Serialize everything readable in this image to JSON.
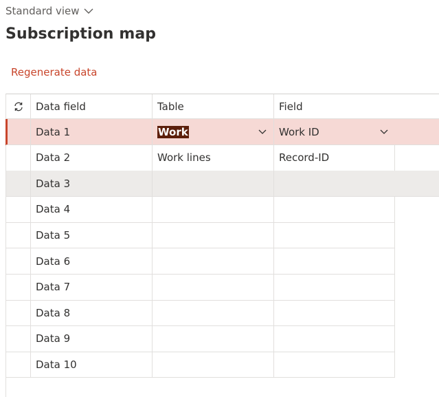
{
  "view": {
    "label": "Standard view"
  },
  "page": {
    "title": "Subscription map"
  },
  "actions": {
    "regenerate_label": "Regenerate data"
  },
  "grid": {
    "columns": [
      "Data field",
      "Table",
      "Field"
    ],
    "rows": [
      {
        "data_field": "Data 1",
        "table": "Work",
        "field": "Work ID"
      },
      {
        "data_field": "Data 2",
        "table": "Work lines",
        "field": "Record-ID"
      },
      {
        "data_field": "Data 3",
        "table": "",
        "field": ""
      },
      {
        "data_field": "Data 4",
        "table": "",
        "field": ""
      },
      {
        "data_field": "Data 5",
        "table": "",
        "field": ""
      },
      {
        "data_field": "Data 6",
        "table": "",
        "field": ""
      },
      {
        "data_field": "Data 7",
        "table": "",
        "field": ""
      },
      {
        "data_field": "Data 8",
        "table": "",
        "field": ""
      },
      {
        "data_field": "Data 9",
        "table": "",
        "field": ""
      },
      {
        "data_field": "Data 10",
        "table": "",
        "field": ""
      }
    ]
  },
  "colors": {
    "accent": "#c8452b",
    "selected_row": "#f6d9d5",
    "hover_row": "#edebe9"
  }
}
